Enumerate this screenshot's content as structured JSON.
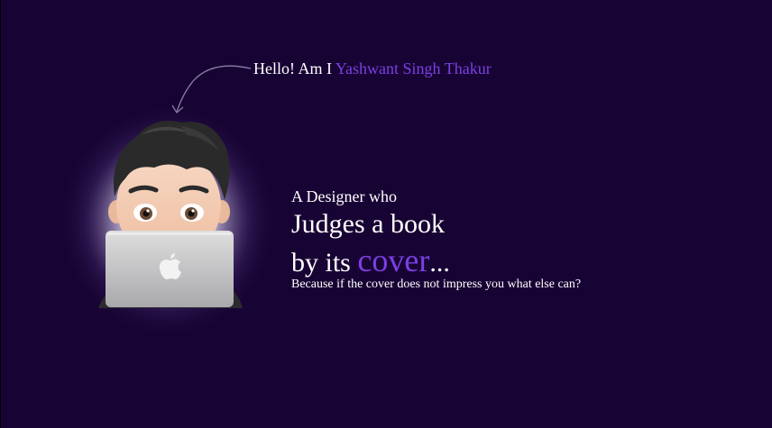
{
  "greeting": {
    "prefix": "Hello! Am I",
    "name": "Yashwant Singh Thakur"
  },
  "tagline": {
    "line1": "A Designer who",
    "line2": "Judges a book",
    "line3_prefix": "by its",
    "line3_accent": "cover",
    "line3_suffix": "...",
    "line4": "Because if the cover does not impress you what else can?"
  },
  "icons": {
    "arrow": "curved-arrow-icon",
    "avatar": "memoji-avatar-with-laptop",
    "laptop_logo": "apple-logo-icon"
  },
  "colors": {
    "background": "#180434",
    "accent": "#7b3fe4",
    "text": "#ffffff"
  }
}
